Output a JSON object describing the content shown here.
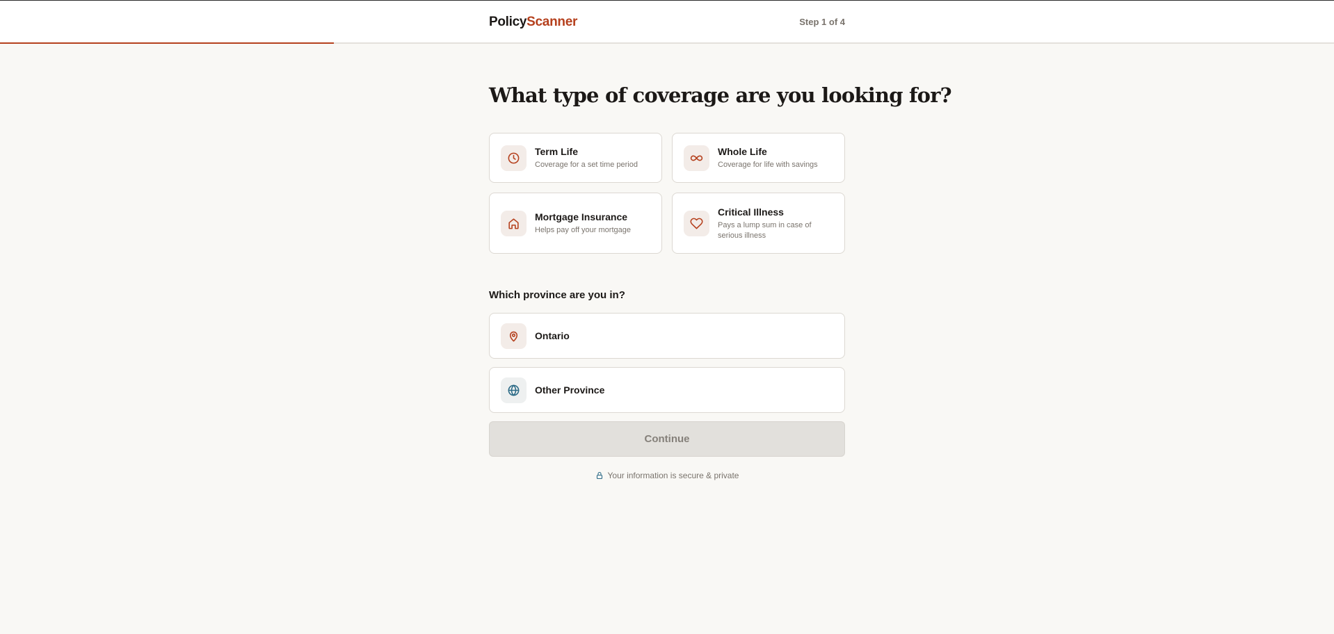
{
  "header": {
    "logo_part1": "Policy",
    "logo_part2": "Scanner",
    "step": "Step 1 of 4",
    "progress": 0.25
  },
  "coverage": {
    "question": "What type of coverage are you looking for?",
    "options": [
      {
        "title": "Term Life",
        "desc": "Coverage for a set time period",
        "icon": "clock-icon"
      },
      {
        "title": "Whole Life",
        "desc": "Coverage for life with savings",
        "icon": "infinity-icon"
      },
      {
        "title": "Mortgage Insurance",
        "desc": "Helps pay off your mortgage",
        "icon": "home-icon"
      },
      {
        "title": "Critical Illness",
        "desc": "Pays a lump sum in case of serious illness",
        "icon": "heart-icon"
      }
    ]
  },
  "province": {
    "question": "Which province are you in?",
    "options": [
      {
        "label": "Ontario",
        "icon": "map-pin-icon"
      },
      {
        "label": "Other Province",
        "icon": "globe-icon"
      }
    ]
  },
  "continue_label": "Continue",
  "secure_text": "Your information is secure & private",
  "colors": {
    "accent": "#b5401d",
    "globe": "#2b6a86",
    "background": "#f9f8f5"
  }
}
